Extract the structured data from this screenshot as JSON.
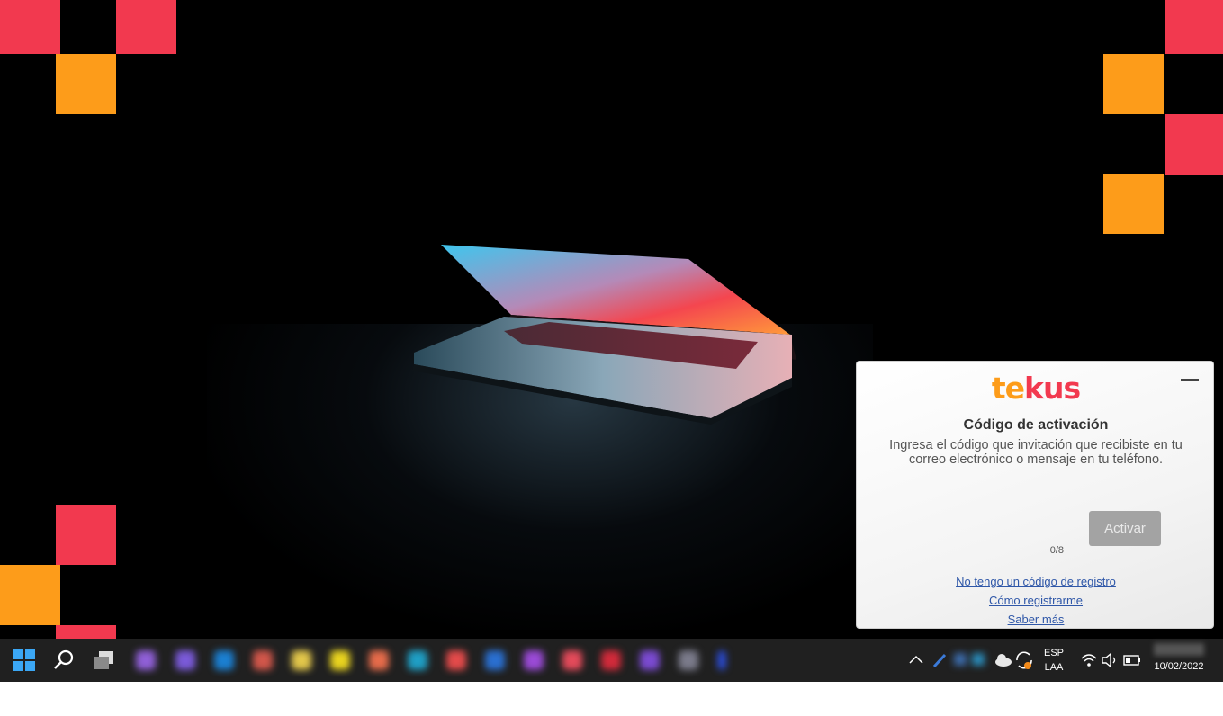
{
  "wallpaper": {
    "brand_colors": {
      "red": "#f2394f",
      "orange": "#fd9c1a"
    }
  },
  "dialog": {
    "logo": {
      "part1": "te",
      "part2": "k",
      "part3": "us"
    },
    "title": "Código de activación",
    "description": "Ingresa el código que invitación que recibiste en tu correo electrónico o mensaje en tu teléfono.",
    "input": {
      "value": "",
      "placeholder": ""
    },
    "counter": "0/8",
    "activate_label": "Activar",
    "links": [
      "No tengo un código de registro",
      "Cómo registrarme",
      "Saber más"
    ]
  },
  "taskbar": {
    "start_icon": "windows-logo-icon",
    "search_icon": "search-icon",
    "task_view_icon": "task-view-icon",
    "apps_blurred": true,
    "language": {
      "line1": "ESP",
      "line2": "LAA"
    },
    "date": "10/02/2022"
  }
}
